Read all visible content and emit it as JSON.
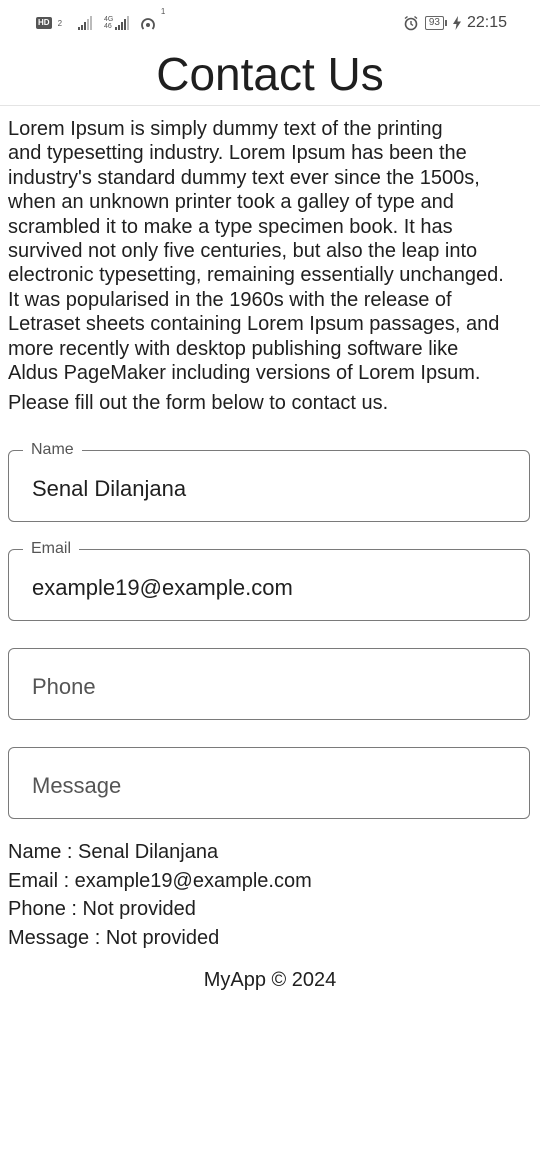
{
  "status_bar": {
    "hd_badge": "HD",
    "sim_slot": "2",
    "network_type": "4G",
    "network_sub": "46",
    "hotspot_count": "1",
    "battery_level": "93",
    "time": "22:15",
    "icons": [
      "signal-icon",
      "signal-4g-icon",
      "hotspot-icon",
      "alarm-icon",
      "battery-icon",
      "charging-icon"
    ]
  },
  "header": {
    "title": "Contact Us"
  },
  "intro": {
    "text": " Lorem Ipsum is simply dummy text of the printing\nand typesetting industry. Lorem Ipsum has been the\nindustry's standard dummy text ever since the 1500s,\nwhen an unknown printer took a galley of type and\nscrambled it to make a type specimen book. It has\nsurvived not only five centuries, but also the leap into\nelectronic typesetting, remaining essentially unchanged.\nIt was popularised in the 1960s with the release of\nLetraset sheets containing Lorem Ipsum passages, and\nmore recently with desktop publishing software like\nAldus PageMaker including versions of Lorem Ipsum.",
    "prompt": "Please fill out the form below to contact us."
  },
  "form": {
    "name": {
      "label": "Name",
      "value": "Senal Dilanjana"
    },
    "email": {
      "label": "Email",
      "value": "example19@example.com"
    },
    "phone": {
      "placeholder": "Phone",
      "value": ""
    },
    "message": {
      "placeholder": "Message",
      "value": ""
    }
  },
  "summary": {
    "name": "Name : Senal Dilanjana",
    "email": "Email : example19@example.com",
    "phone": "Phone : Not provided",
    "message": "Message : Not provided"
  },
  "footer": {
    "text": "MyApp © 2024"
  }
}
